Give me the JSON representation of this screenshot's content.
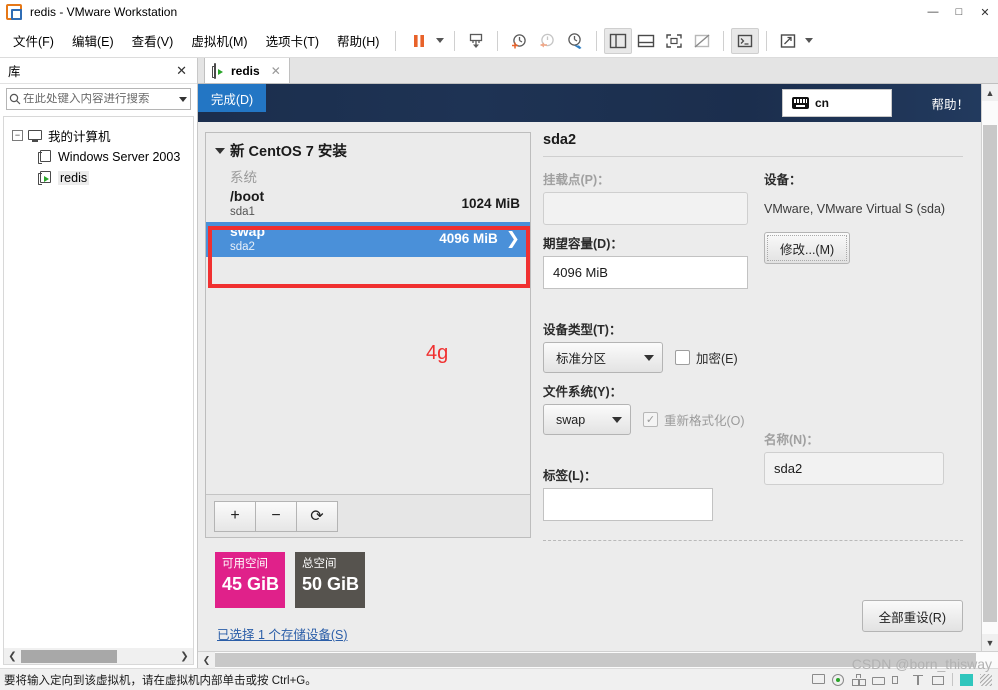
{
  "window": {
    "title": "redis - VMware Workstation",
    "logo_icon": "vmware-logo-icon",
    "controls": {
      "minimize": "—",
      "maximize": "□",
      "close": "✕"
    }
  },
  "menubar": {
    "items": [
      {
        "label": "文件(F)",
        "name": "menu-file"
      },
      {
        "label": "编辑(E)",
        "name": "menu-edit"
      },
      {
        "label": "查看(V)",
        "name": "menu-view"
      },
      {
        "label": "虚拟机(M)",
        "name": "menu-vm"
      },
      {
        "label": "选项卡(T)",
        "name": "menu-tabs"
      },
      {
        "label": "帮助(H)",
        "name": "menu-help"
      }
    ]
  },
  "toolbar": {
    "icons": [
      {
        "name": "suspend-icon",
        "glyph": "pause"
      },
      {
        "name": "power-dropdown-caret",
        "glyph": "caret"
      },
      {
        "name": "snapshot-take-icon",
        "glyph": "snapshot"
      },
      {
        "name": "snapshot-manager-icon",
        "glyph": "clock-plus"
      },
      {
        "name": "snapshot-revert-icon",
        "glyph": "clock-back"
      },
      {
        "name": "snapshot-settings-icon",
        "glyph": "clock-wrench"
      },
      {
        "name": "show-library-icon",
        "glyph": "panel-left"
      },
      {
        "name": "show-thumbnail-bar-icon",
        "glyph": "panel-bottom"
      },
      {
        "name": "fullscreen-icon",
        "glyph": "fullscreen"
      },
      {
        "name": "unity-mode-icon",
        "glyph": "unity"
      },
      {
        "name": "console-view-icon",
        "glyph": "console"
      },
      {
        "name": "stretch-view-icon",
        "glyph": "stretch"
      },
      {
        "name": "stretch-dropdown-caret",
        "glyph": "caret"
      }
    ]
  },
  "library": {
    "title": "库",
    "close_glyph": "✕",
    "search": {
      "placeholder": "在此处键入内容进行搜索",
      "value": "",
      "icon": "search-icon"
    },
    "tree": [
      {
        "label": "我的计算机",
        "icon": "monitor-icon",
        "level": 0,
        "expanded": true,
        "expander": "−"
      },
      {
        "label": "Windows Server 2003",
        "icon": "vm-icon",
        "level": 1,
        "selected": false
      },
      {
        "label": "redis",
        "icon": "vm-running-icon",
        "level": 1,
        "selected": true
      }
    ]
  },
  "tabs": [
    {
      "label": "redis",
      "icon": "vm-running-icon",
      "close_glyph": "✕",
      "active": true
    }
  ],
  "guest": {
    "installer": {
      "done_button": "完成(D)",
      "keyboard_layout": "cn",
      "keyboard_icon": "keyboard-icon",
      "help_button": "帮助！"
    },
    "partition_panel": {
      "group_title": "新 CentOS 7 安装",
      "section_label": "系统",
      "rows": [
        {
          "name": "/boot",
          "device": "sda1",
          "size": "1024 MiB",
          "selected": false
        },
        {
          "name": "swap",
          "device": "sda2",
          "size": "4096 MiB",
          "selected": true,
          "chevron": "❯"
        }
      ],
      "toolbar": {
        "add": "+",
        "remove": "−",
        "refresh": "⟳"
      },
      "capacity": {
        "free_label": "可用空间",
        "free_value": "45 GiB",
        "free_color": "#e0218a",
        "total_label": "总空间",
        "total_value": "50 GiB",
        "total_color": "#56534e"
      },
      "storage_link": "已选择 1 个存储设备(S)"
    },
    "detail_panel": {
      "title": "sda2",
      "mount_point": {
        "label": "挂载点(P)：",
        "value": "",
        "disabled": true
      },
      "desired_capacity": {
        "label": "期望容量(D)：",
        "value": "4096 MiB"
      },
      "device_type": {
        "label": "设备类型(T)：",
        "value": "标准分区",
        "encrypt_label": "加密(E)",
        "encrypt_checked": false
      },
      "file_system": {
        "label": "文件系统(Y)：",
        "value": "swap",
        "reformat_label": "重新格式化(O)",
        "reformat_checked": true,
        "reformat_disabled": true
      },
      "device": {
        "label": "设备：",
        "value": "VMware, VMware Virtual S (sda)",
        "modify_button": "修改...(M)"
      },
      "label_field": {
        "label": "标签(L)：",
        "value": ""
      },
      "name_field": {
        "label": "名称(N)：",
        "value": "sda2",
        "disabled": true
      },
      "reset_all_button": "全部重设(R)"
    },
    "annotation": {
      "text": "4g",
      "color": "#f03030"
    }
  },
  "statusbar": {
    "message": "要将输入定向到该虚拟机，请在虚拟机内部单击或按 Ctrl+G。",
    "icons": [
      {
        "name": "hard-disk-icon"
      },
      {
        "name": "cd-dvd-icon"
      },
      {
        "name": "network-adapter-icon"
      },
      {
        "name": "printer-icon"
      },
      {
        "name": "sound-card-icon"
      },
      {
        "name": "usb-controller-icon"
      },
      {
        "name": "display-icon"
      },
      {
        "name": "vm-status-icon"
      },
      {
        "name": "resize-grip-icon"
      }
    ]
  },
  "watermark": "CSDN @born_thisway"
}
